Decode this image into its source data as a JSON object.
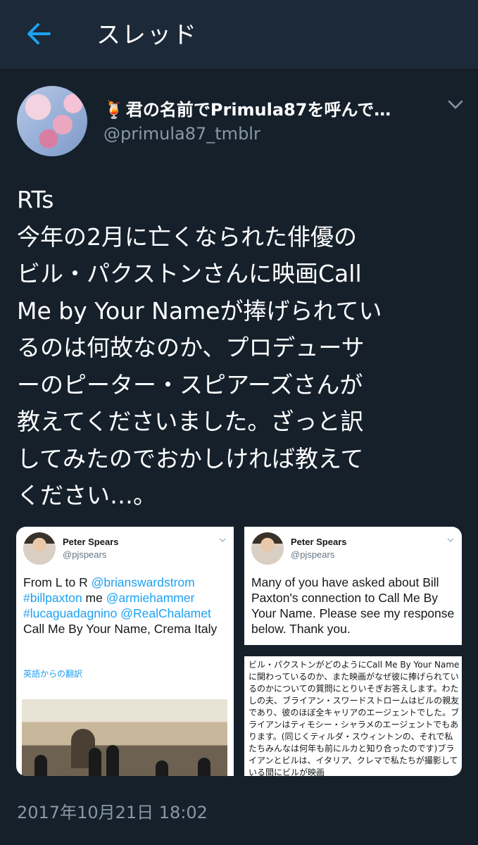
{
  "header": {
    "title": "スレッド",
    "back_icon": "arrow-left-icon"
  },
  "tweet": {
    "author_name": "君の名前でPrimula87を呼んで…",
    "author_emoji": "🍹",
    "author_handle": "@primula87_tmblr",
    "text_lines": [
      "RTs",
      "今年の2月に亡くなられた俳優の",
      "ビル・パクストンさんに映画Call",
      "Me by Your Nameが捧げられてい",
      "るのは何故なのか、プロデューサ",
      "ーのピーター・スピアーズさんが",
      "教えてくださいました。ざっと訳",
      "してみたのでおかしければ教えて",
      "ください…。"
    ],
    "timestamp": "2017年10月21日 18:02"
  },
  "card_left": {
    "name": "Peter Spears",
    "handle": "@pjspears",
    "body_prefix": "From L to R ",
    "mention_1": "@brianswardstrom",
    "hashtag_1": "#billpaxton",
    "body_me": " me ",
    "mention_2": "@armiehammer",
    "hashtag_2": "#lucaguadagnino",
    "mention_3": "@RealChalamet",
    "body_suffix": "Call Me By Your Name, Crema Italy",
    "translate_label": "英語からの翻訳"
  },
  "card_right_top": {
    "name": "Peter Spears",
    "handle": "@pjspears",
    "body": "Many of you have asked about Bill Paxton's connection to Call Me By Your Name. Please see my response below.  Thank you."
  },
  "card_right_bottom": {
    "body": "ビル・パクストンがどのようにCall Me By Your Nameに関わっているのか、また映画がなぜ彼に捧げられているのかについての質問にとりいそぎお答えします。わたしの夫、ブライアン・スワードストロームはビルの親友であり、彼のほぼ全キャリアのエージェントでした。ブライアンはティモシー・シャラメのエージェントでもあります。(同じくティルダ・スウィントンの、それで私たちみんなは何年も前にルカと知り合ったのです)ブライアンとビルは、イタリア、クレマで私たちが撮影している間にビルが映画"
  },
  "colors": {
    "background": "#15202b",
    "header": "#1c2938",
    "accent": "#1da1f2",
    "muted": "#8899a6"
  }
}
